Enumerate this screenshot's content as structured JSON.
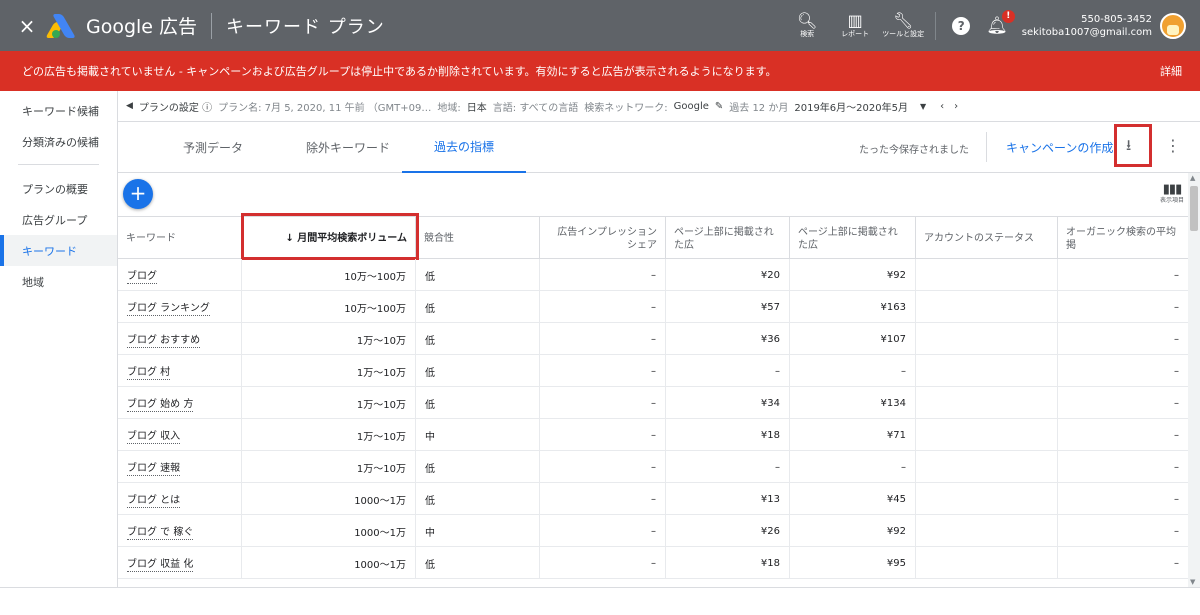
{
  "header": {
    "close_icon": "×",
    "brand": "Google 広告",
    "title": "キーワード プラン",
    "tools": [
      {
        "icon": "search-icon",
        "glyph": "🔍︎",
        "label": "検索"
      },
      {
        "icon": "report-icon",
        "glyph": "▥",
        "label": "レポート"
      },
      {
        "icon": "wrench-icon",
        "glyph": "🔧︎",
        "label": "ツールと設定"
      }
    ],
    "help_glyph": "?",
    "bell_badge": "!",
    "phone": "550-805-3452",
    "email": "sekitoba1007@gmail.com"
  },
  "banner": {
    "message": "どの広告も掲載されていません - キャンペーンおよび広告グループは停止中であるか削除されています。有効にすると広告が表示されるようになります。",
    "detail_link": "詳細"
  },
  "sidebar": {
    "items": [
      {
        "label": "キーワード候補"
      },
      {
        "label": "分類済みの候補"
      },
      {
        "label": "プランの概要"
      },
      {
        "label": "広告グループ"
      },
      {
        "label": "キーワード",
        "active": true
      },
      {
        "label": "地域"
      }
    ]
  },
  "breadcrumb": {
    "plan_settings": "プランの設定 ⓘ",
    "plan_name": "プラン名: 7月 5, 2020, 11 午前 （GMT+09…",
    "region_label": "地域:",
    "region": "日本",
    "language": "言語: すべての言語",
    "network_label": "検索ネットワーク:",
    "network": "Google",
    "period_label": "過去 12 か月",
    "period": "2019年6月～2020年5月"
  },
  "tabs": [
    {
      "label": "予測データ"
    },
    {
      "label": "除外キーワード"
    },
    {
      "label": "過去の指標",
      "active": true
    }
  ],
  "toolbar": {
    "saved_text": "たった今保存されました",
    "create_campaign": "キャンペーンの作成",
    "download_glyph": "⭳",
    "more_glyph": "⋮",
    "add_glyph": "+",
    "columns_label": "表示項目"
  },
  "table": {
    "columns": [
      {
        "label": "キーワード"
      },
      {
        "label": "↓ 月間平均検索ボリューム",
        "sorted": true
      },
      {
        "label": "競合性"
      },
      {
        "label": "広告インプレッション シェア"
      },
      {
        "label": "ページ上部に掲載された広"
      },
      {
        "label": "ページ上部に掲載された広"
      },
      {
        "label": "アカウントのステータス"
      },
      {
        "label": "オーガニック検索の平均掲"
      }
    ],
    "rows": [
      {
        "keyword": "ブログ",
        "volume": "10万～100万",
        "competition": "低",
        "impression": "–",
        "top_low": "¥20",
        "top_high": "¥92",
        "status": "",
        "organic": "–"
      },
      {
        "keyword": "ブログ ランキング",
        "volume": "10万～100万",
        "competition": "低",
        "impression": "–",
        "top_low": "¥57",
        "top_high": "¥163",
        "status": "",
        "organic": "–"
      },
      {
        "keyword": "ブログ おすすめ",
        "volume": "1万～10万",
        "competition": "低",
        "impression": "–",
        "top_low": "¥36",
        "top_high": "¥107",
        "status": "",
        "organic": "–"
      },
      {
        "keyword": "ブログ 村",
        "volume": "1万～10万",
        "competition": "低",
        "impression": "–",
        "top_low": "–",
        "top_high": "–",
        "status": "",
        "organic": "–"
      },
      {
        "keyword": "ブログ 始め 方",
        "volume": "1万～10万",
        "competition": "低",
        "impression": "–",
        "top_low": "¥34",
        "top_high": "¥134",
        "status": "",
        "organic": "–"
      },
      {
        "keyword": "ブログ 収入",
        "volume": "1万～10万",
        "competition": "中",
        "impression": "–",
        "top_low": "¥18",
        "top_high": "¥71",
        "status": "",
        "organic": "–"
      },
      {
        "keyword": "ブログ 速報",
        "volume": "1万～10万",
        "competition": "低",
        "impression": "–",
        "top_low": "–",
        "top_high": "–",
        "status": "",
        "organic": "–"
      },
      {
        "keyword": "ブログ とは",
        "volume": "1000～1万",
        "competition": "低",
        "impression": "–",
        "top_low": "¥13",
        "top_high": "¥45",
        "status": "",
        "organic": "–"
      },
      {
        "keyword": "ブログ で 稼ぐ",
        "volume": "1000～1万",
        "competition": "中",
        "impression": "–",
        "top_low": "¥26",
        "top_high": "¥92",
        "status": "",
        "organic": "–"
      },
      {
        "keyword": "ブログ 収益 化",
        "volume": "1000～1万",
        "competition": "低",
        "impression": "–",
        "top_low": "¥18",
        "top_high": "¥95",
        "status": "",
        "organic": "–"
      }
    ]
  }
}
